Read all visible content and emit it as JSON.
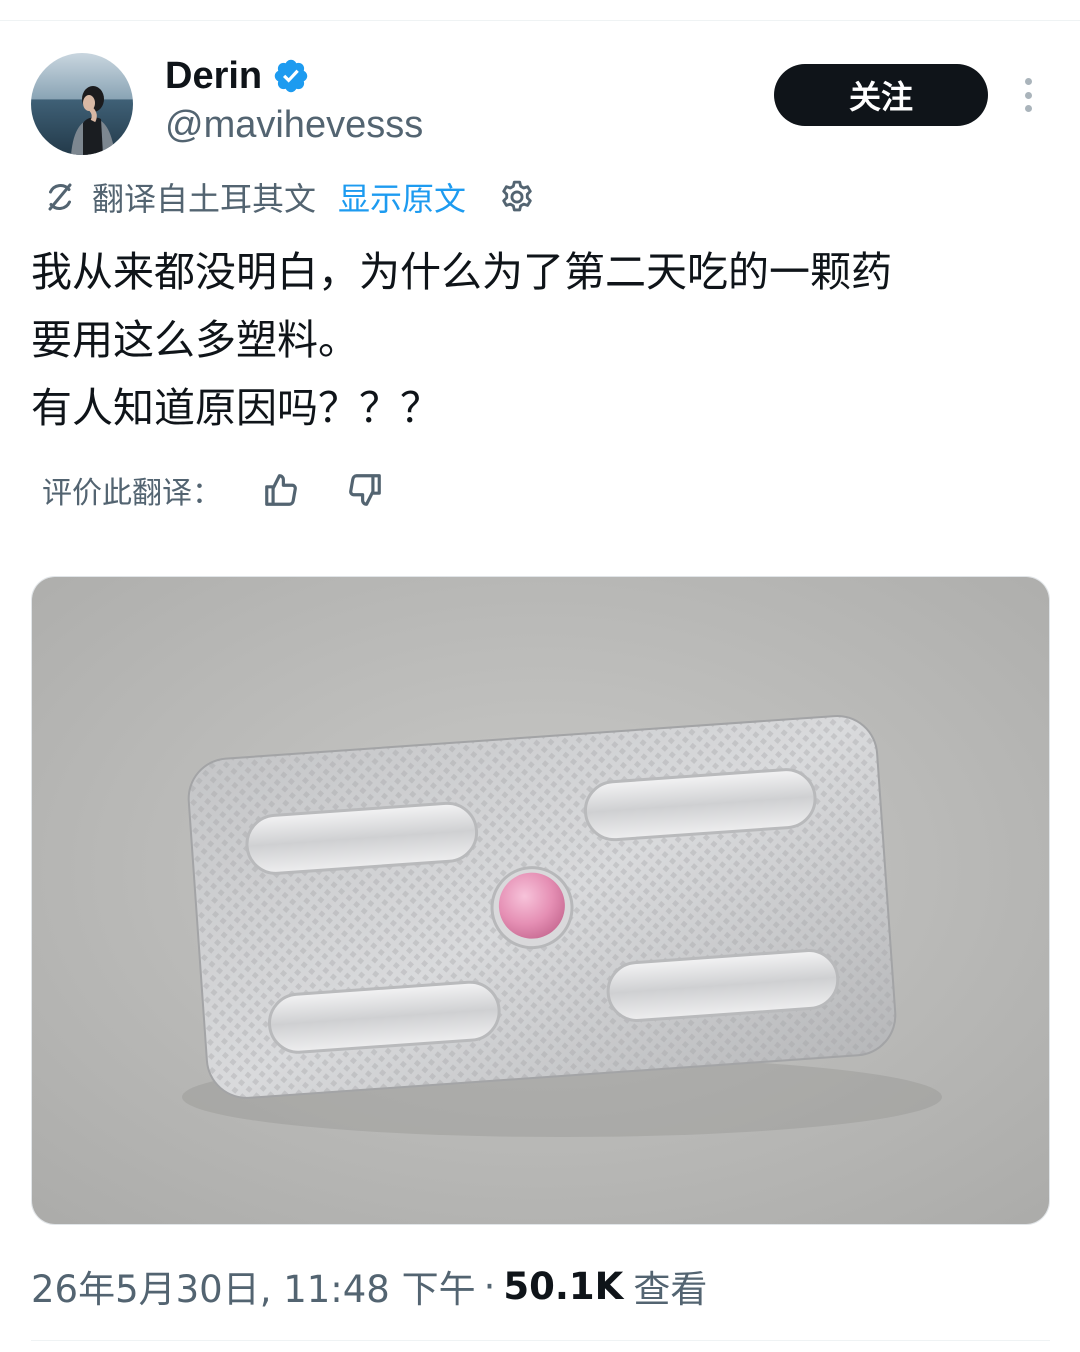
{
  "author": {
    "display_name": "Derin",
    "handle": "@mavihevesss",
    "verified": true,
    "avatar_icon": "user-avatar-photo"
  },
  "header": {
    "follow_label": "关注",
    "more_icon": "more-vertical-icon"
  },
  "translation": {
    "translated_from": "翻译自土耳其文",
    "show_original": "显示原文",
    "rate_label": "评价此翻译：",
    "link_color": "#1d9bf0"
  },
  "tweet": {
    "lines": [
      "我从来都没明白，为什么为了第二天吃的一颗药",
      "要用这么多塑料。",
      "有人知道原因吗？？？"
    ]
  },
  "media": {
    "description_icon": "blister-pack-photo",
    "pill_color": "#e58fb4"
  },
  "meta": {
    "timestamp": "26年5月30日, 11:48 下午",
    "separator": "·",
    "views_count": "50.1K",
    "views_label": "查看"
  },
  "colors": {
    "primary_text": "#0f1419",
    "secondary_text": "#536471",
    "follow_bg": "#0f1419",
    "verified_badge": "#1d9bf0"
  }
}
